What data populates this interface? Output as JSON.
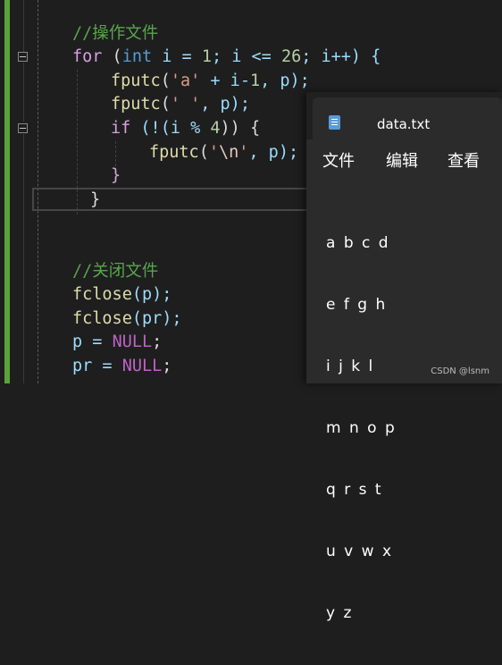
{
  "editor": {
    "lines": {
      "c1": "//操作文件",
      "for_kw": "for",
      "for_rest_a": " (",
      "int_kw": "int",
      "for_rest_b": " i = ",
      "n1": "1",
      "for_rest_c": "; i <= ",
      "n26": "26",
      "for_rest_d": "; i++) {",
      "fputc1_fn": "fputc",
      "fputc1_a": "(",
      "fputc1_str": "'a'",
      "fputc1_b": " + i-",
      "fputc1_num": "1",
      "fputc1_c": ", p);",
      "fputc2_fn": "fputc",
      "fputc2_a": "(",
      "fputc2_str": "' '",
      "fputc2_c": ", p);",
      "if_kw": "if",
      "if_a": " (!(i % ",
      "if_num": "4",
      "if_b": ")) {",
      "fputc3_fn": "fputc",
      "fputc3_a": "(",
      "fputc3_q1": "'",
      "fputc3_esc": "\\n",
      "fputc3_q2": "'",
      "fputc3_c": ", p);",
      "brace_inner": "}",
      "brace_outer": "}",
      "c2": "//关闭文件",
      "fclose1_fn": "fclose",
      "fclose1_rest": "(p);",
      "fclose2_fn": "fclose",
      "fclose2_rest": "(pr);",
      "p_null_a": "p = ",
      "p_null_m": "NULL",
      "p_null_b": ";",
      "pr_null_a": "pr = ",
      "pr_null_m": "NULL",
      "pr_null_b": ";"
    }
  },
  "notepad": {
    "tab_title": "data.txt",
    "menu": [
      "文件",
      "编辑",
      "查看"
    ],
    "content_rows": [
      "a b c d",
      "e f g h",
      "i j k l",
      "m n o p",
      "q r s t",
      "u v w x",
      "y z"
    ]
  },
  "watermark": "CSDN @lsnm",
  "colors": {
    "change_bar": "#5aa33b",
    "keyword": "#569cd6",
    "comment": "#57a64a",
    "string": "#d69d85",
    "macro": "#bd63c5"
  }
}
